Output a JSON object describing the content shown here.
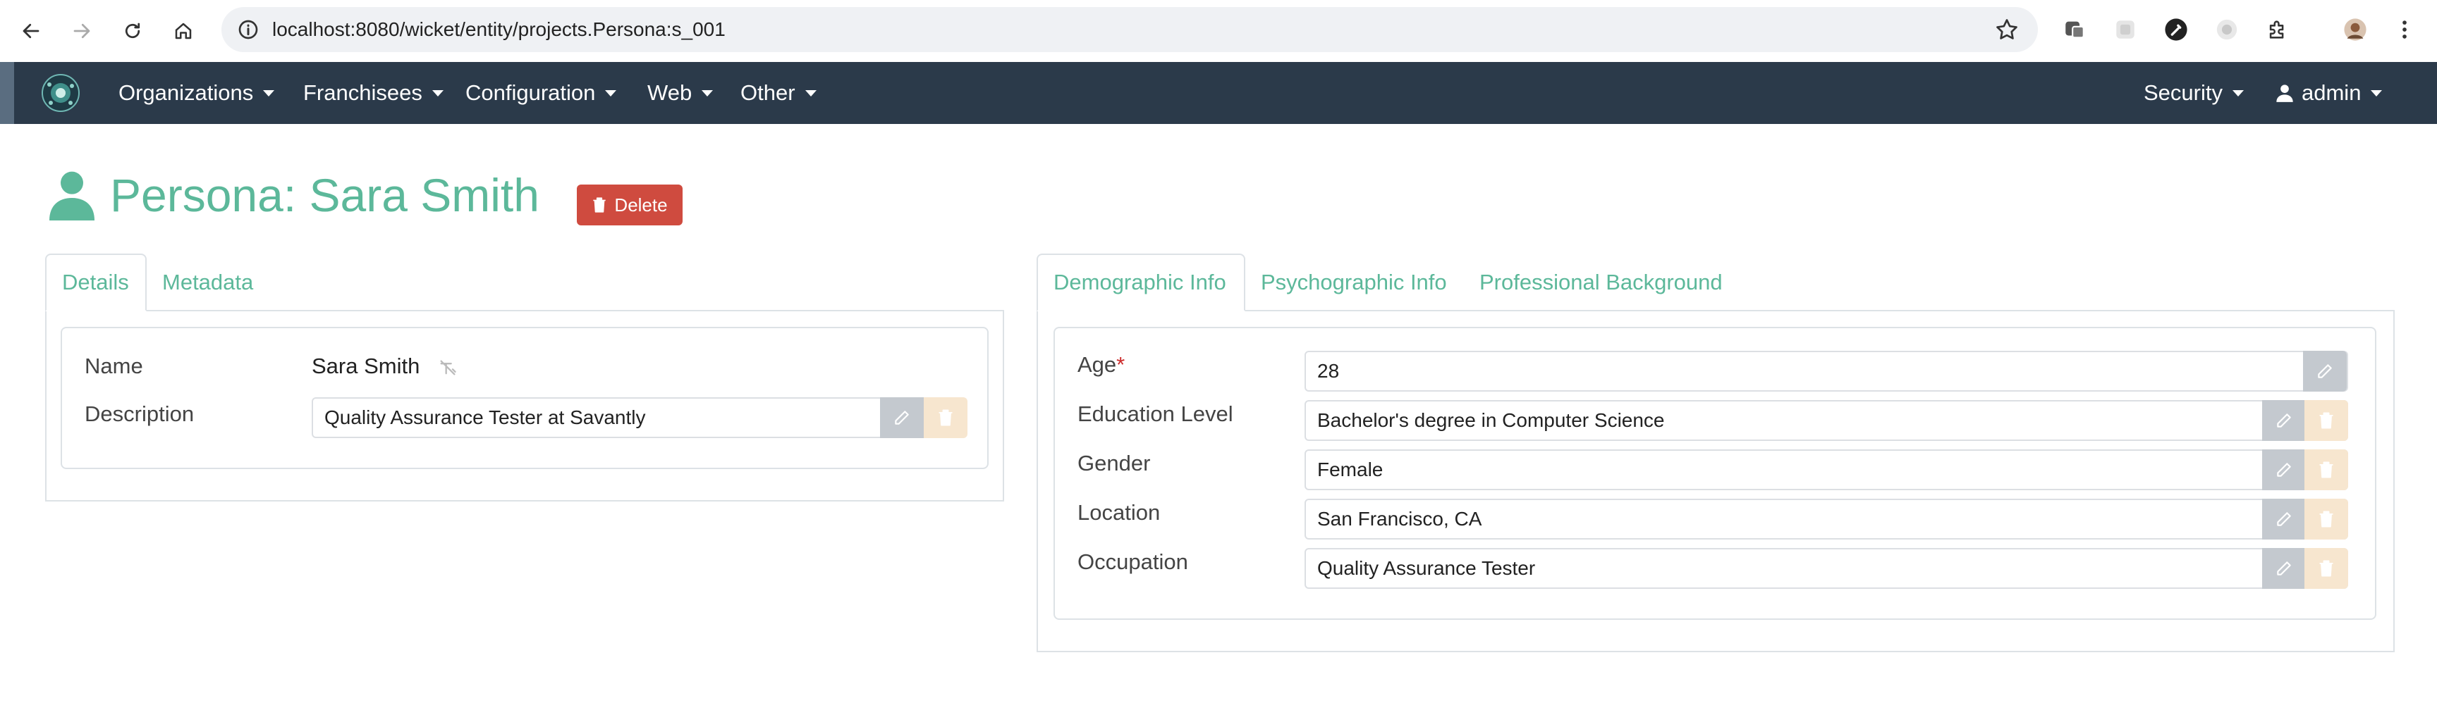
{
  "browser": {
    "url": "localhost:8080/wicket/entity/projects.Persona:s_001",
    "icons": [
      "back-icon",
      "forward-icon",
      "reload-icon",
      "home-icon",
      "info-icon",
      "star-icon",
      "extension-icon",
      "eyedropper-icon",
      "puzzle-icon",
      "profile-avatar",
      "more-icon"
    ]
  },
  "navbar": {
    "menu": [
      {
        "label": "Organizations"
      },
      {
        "label": "Franchisees"
      },
      {
        "label": "Configuration"
      },
      {
        "label": "Web"
      },
      {
        "label": "Other"
      }
    ],
    "security_label": "Security",
    "user_label": "admin"
  },
  "page": {
    "title": "Persona: Sara Smith",
    "delete_label": "Delete"
  },
  "left_panel": {
    "tabs": [
      {
        "label": "Details"
      },
      {
        "label": "Metadata"
      }
    ],
    "name_label": "Name",
    "name_value": "Sara Smith",
    "description_label": "Description",
    "description_value": "Quality Assurance Tester at Savantly"
  },
  "right_panel": {
    "tabs": [
      {
        "label": "Demographic Info"
      },
      {
        "label": "Psychographic Info"
      },
      {
        "label": "Professional Background"
      }
    ],
    "fields": [
      {
        "label": "Age",
        "value": "28",
        "required_mark": "*"
      },
      {
        "label": "Education Level",
        "value": "Bachelor's degree in Computer Science"
      },
      {
        "label": "Gender",
        "value": "Female"
      },
      {
        "label": "Location",
        "value": "San Francisco, CA"
      },
      {
        "label": "Occupation",
        "value": "Quality Assurance Tester"
      }
    ]
  },
  "colors": {
    "navbar": "#2b3a4a",
    "accent": "#5cb89a",
    "delete": "#cf4b3f"
  }
}
